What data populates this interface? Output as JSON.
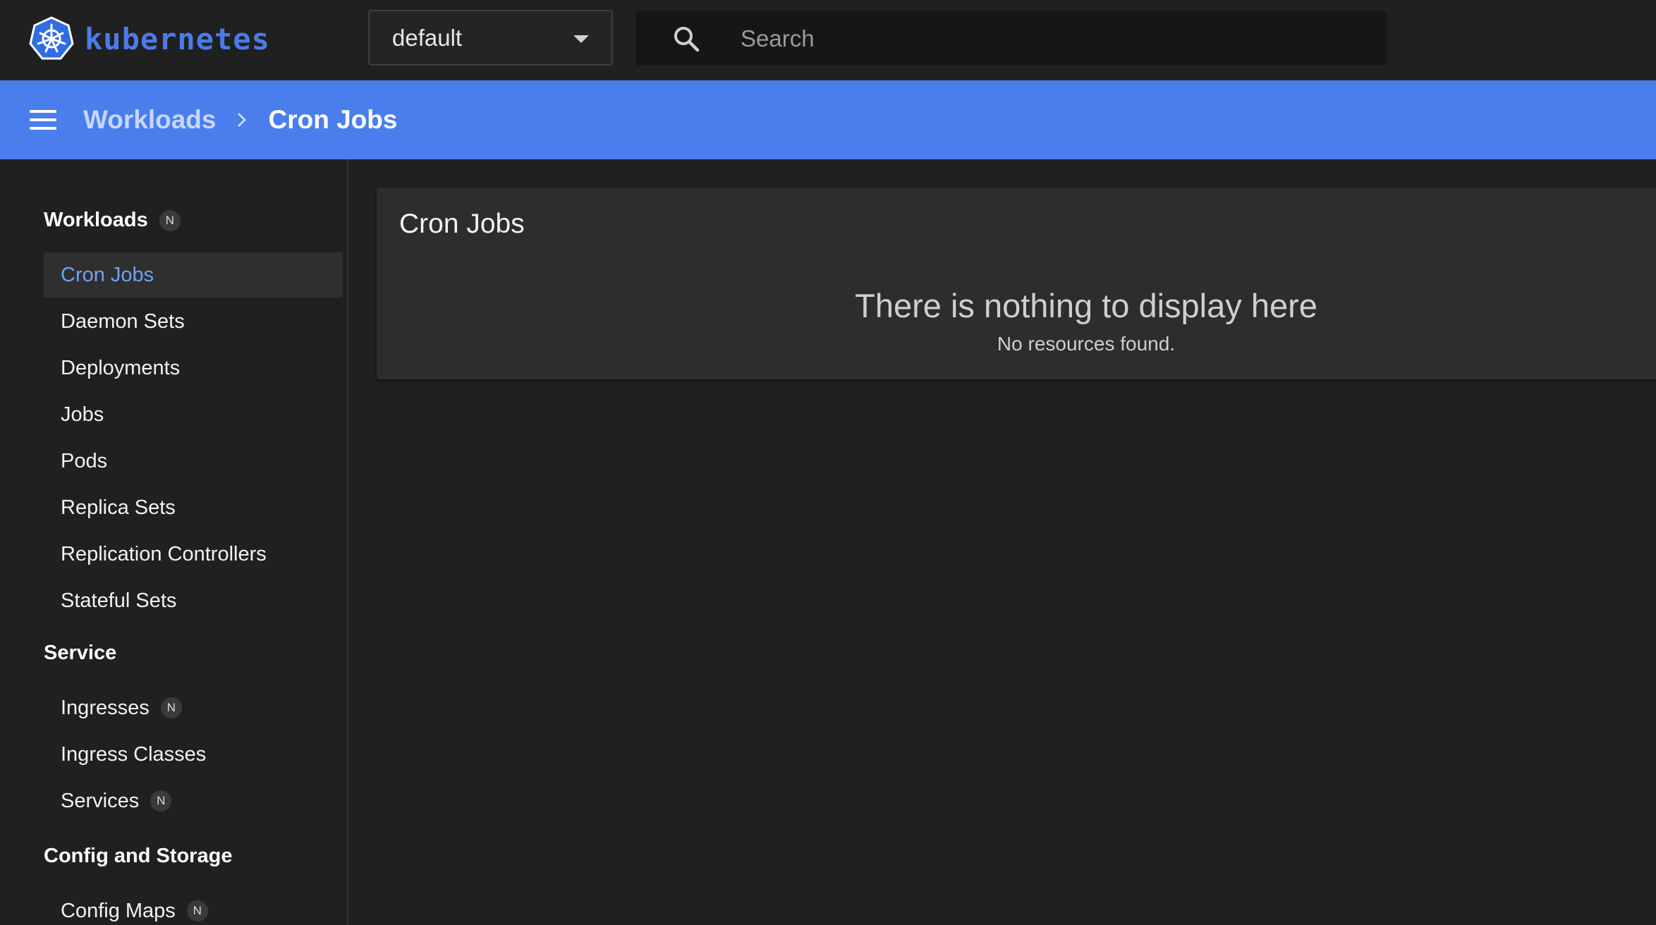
{
  "brand": {
    "name": "kubernetes",
    "color": "#4b7be8"
  },
  "namespace_selector": {
    "value": "default",
    "icon": "chevron-down-icon"
  },
  "search": {
    "placeholder": "Search",
    "value": "",
    "icon": "search-icon"
  },
  "breadcrumb": {
    "parent": "Workloads",
    "current": "Cron Jobs",
    "bar_color": "#4a7eec"
  },
  "sidebar": {
    "sections": [
      {
        "label": "Workloads",
        "badge": "N",
        "items": [
          {
            "label": "Cron Jobs",
            "active": true
          },
          {
            "label": "Daemon Sets"
          },
          {
            "label": "Deployments"
          },
          {
            "label": "Jobs"
          },
          {
            "label": "Pods"
          },
          {
            "label": "Replica Sets"
          },
          {
            "label": "Replication Controllers"
          },
          {
            "label": "Stateful Sets"
          }
        ]
      },
      {
        "label": "Service",
        "items": [
          {
            "label": "Ingresses",
            "badge": "N"
          },
          {
            "label": "Ingress Classes"
          },
          {
            "label": "Services",
            "badge": "N"
          }
        ]
      },
      {
        "label": "Config and Storage",
        "items": [
          {
            "label": "Config Maps",
            "badge": "N"
          }
        ]
      }
    ]
  },
  "main": {
    "card_title": "Cron Jobs",
    "empty_title": "There is nothing to display here",
    "empty_subtitle": "No resources found."
  }
}
